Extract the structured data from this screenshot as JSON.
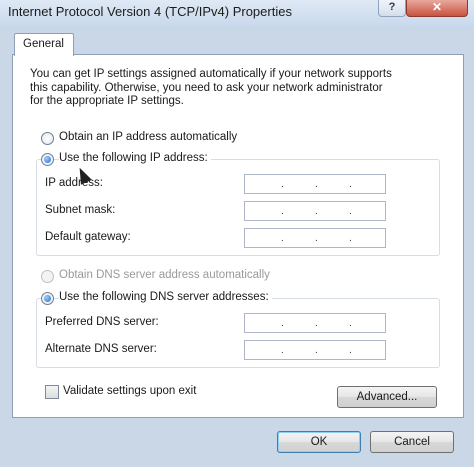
{
  "window": {
    "title": "Internet Protocol Version 4 (TCP/IPv4) Properties",
    "help_label": "?",
    "close_label": "✕"
  },
  "tabs": [
    {
      "label": "General"
    }
  ],
  "intro": {
    "line1": "You can get IP settings assigned automatically if your network supports",
    "line2": "this capability. Otherwise, you need to ask your network administrator",
    "line3": "for the appropriate IP settings."
  },
  "ip_options": {
    "auto_label": "Obtain an IP address automatically",
    "manual_label": "Use the following IP address:",
    "selected": "manual"
  },
  "ip_fields": {
    "ip_address_label": "IP address:",
    "subnet_mask_label": "Subnet mask:",
    "default_gateway_label": "Default gateway:",
    "ip_address_value": "",
    "subnet_mask_value": "",
    "default_gateway_value": ""
  },
  "dns_options": {
    "auto_label": "Obtain DNS server address automatically",
    "manual_label": "Use the following DNS server addresses:",
    "selected": "manual"
  },
  "dns_fields": {
    "preferred_label": "Preferred DNS server:",
    "alternate_label": "Alternate DNS server:",
    "preferred_value": "",
    "alternate_value": ""
  },
  "validate": {
    "label": "Validate settings upon exit",
    "checked": false
  },
  "buttons": {
    "advanced": "Advanced...",
    "ok": "OK",
    "cancel": "Cancel"
  },
  "colors": {
    "window_bg": "#c9d7e6",
    "accent": "#1f6cc6",
    "close": "#c8523f"
  }
}
